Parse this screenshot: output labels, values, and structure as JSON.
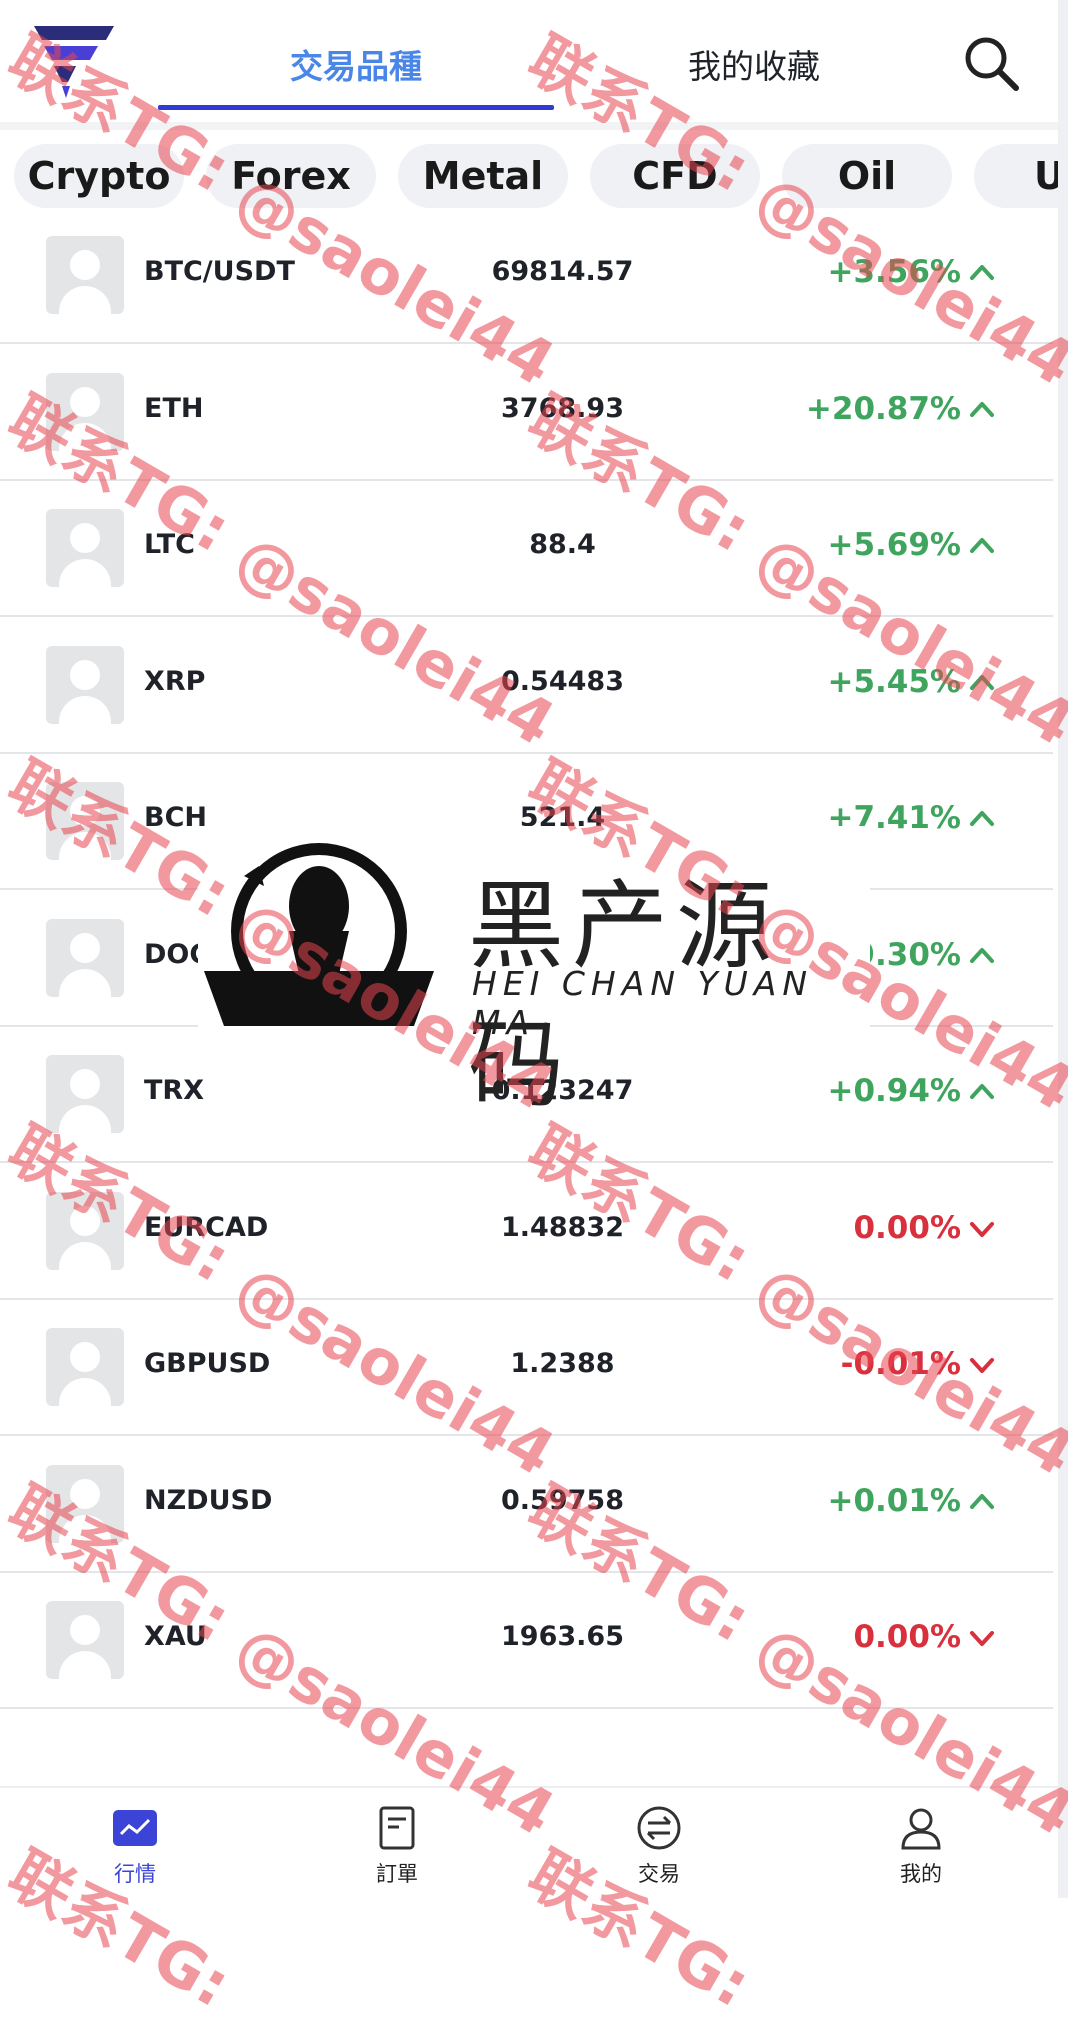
{
  "header": {
    "tab_markets": "交易品種",
    "tab_favorites": "我的收藏"
  },
  "categories": [
    "Crypto",
    "Forex",
    "Metal",
    "CFD",
    "Oil",
    "U"
  ],
  "quotes": [
    {
      "symbol": "BTC/USDT",
      "price": "69814.57",
      "change": "+3.56%",
      "direction": "up"
    },
    {
      "symbol": "ETH",
      "price": "3768.93",
      "change": "+20.87%",
      "direction": "up"
    },
    {
      "symbol": "LTC",
      "price": "88.4",
      "change": "+5.69%",
      "direction": "up"
    },
    {
      "symbol": "XRP",
      "price": "0.54483",
      "change": "+5.45%",
      "direction": "up"
    },
    {
      "symbol": "BCH",
      "price": "521.4",
      "change": "+7.41%",
      "direction": "up"
    },
    {
      "symbol": "DOGE",
      "price": "",
      "change": "+9.30%",
      "direction": "up"
    },
    {
      "symbol": "TRX",
      "price": "0.123247",
      "change": "+0.94%",
      "direction": "up"
    },
    {
      "symbol": "EURCAD",
      "price": "1.48832",
      "change": "0.00%",
      "direction": "down"
    },
    {
      "symbol": "GBPUSD",
      "price": "1.2388",
      "change": "-0.01%",
      "direction": "down"
    },
    {
      "symbol": "NZDUSD",
      "price": "0.59758",
      "change": "+0.01%",
      "direction": "up"
    },
    {
      "symbol": "XAU",
      "price": "1963.65",
      "change": "0.00%",
      "direction": "down"
    }
  ],
  "nav": [
    {
      "label": "行情",
      "icon": "chart-icon",
      "active": true
    },
    {
      "label": "訂單",
      "icon": "order-icon",
      "active": false
    },
    {
      "label": "交易",
      "icon": "exchange-icon",
      "active": false
    },
    {
      "label": "我的",
      "icon": "user-icon",
      "active": false
    }
  ],
  "brand": {
    "name_cn": "黑产源码",
    "name_en": "HEI CHAN YUAN MA"
  },
  "watermark": {
    "line1": "联系TG:",
    "line2": "@saolei44"
  },
  "colors": {
    "up": "#3fa45d",
    "down": "#d9303e",
    "accent": "#4a86e8",
    "nav_active": "#3b44d6"
  }
}
